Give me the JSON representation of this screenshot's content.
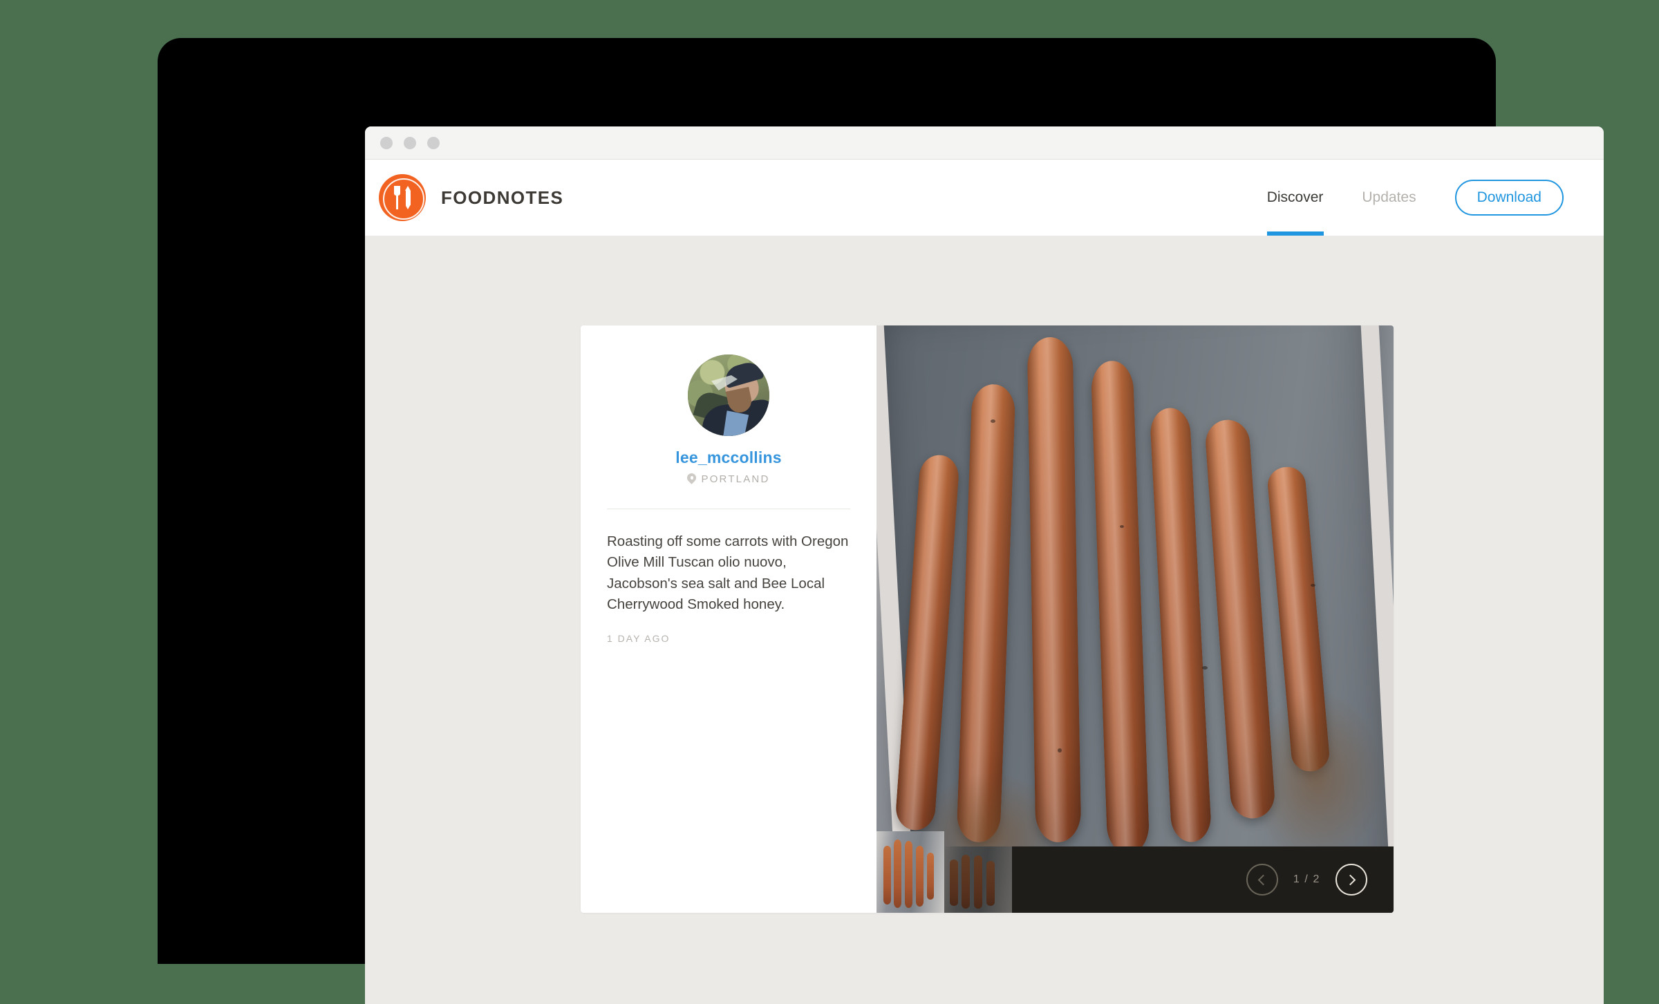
{
  "window": {
    "traffic_lights": [
      "close",
      "minimize",
      "maximize"
    ]
  },
  "header": {
    "brand_name": "FOODNOTES",
    "logo_icon": "fork-and-pencil-icon",
    "nav": [
      {
        "label": "Discover",
        "active": true
      },
      {
        "label": "Updates",
        "active": false
      }
    ],
    "download_label": "Download",
    "accent_blue": "#2196e0",
    "brand_orange": "#f26322"
  },
  "post": {
    "avatar_icon": "user-avatar",
    "username": "lee_mccollins",
    "location_icon": "map-pin-icon",
    "location": "PORTLAND",
    "caption": "Roasting off some carrots with Oregon Olive Mill Tuscan olio nuovo, Jacobson's sea salt and Bee Local Cherrywood Smoked honey.",
    "timestamp": "1 DAY AGO"
  },
  "carousel": {
    "counter": "1 / 2",
    "prev_icon": "chevron-left-icon",
    "next_icon": "chevron-right-icon",
    "prev_enabled": false,
    "next_enabled": true,
    "thumbnails": [
      {
        "label": "roasted-carrots-photo-1",
        "active": true
      },
      {
        "label": "roasted-carrots-photo-2",
        "active": false
      }
    ],
    "current_image_alt": "roasted carrots in a baking dish"
  },
  "theme": {
    "page_background": "#ebeae6",
    "desktop_background": "#4a7050",
    "card_background": "#ffffff",
    "strip_background": "#1f1d1a"
  }
}
